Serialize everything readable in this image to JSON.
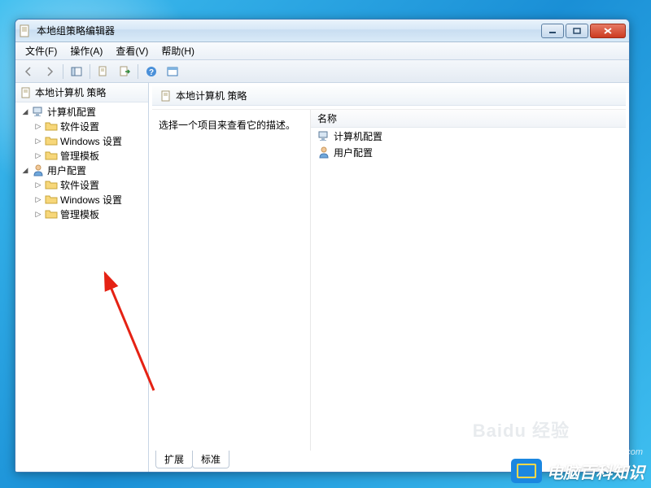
{
  "window": {
    "title": "本地组策略编辑器"
  },
  "menu": {
    "file": "文件(F)",
    "action": "操作(A)",
    "view": "查看(V)",
    "help": "帮助(H)"
  },
  "tree": {
    "root": "本地计算机 策略",
    "computer_config": "计算机配置",
    "software_settings": "软件设置",
    "windows_settings": "Windows 设置",
    "admin_templates": "管理模板",
    "user_config": "用户配置"
  },
  "main": {
    "header": "本地计算机 策略",
    "description": "选择一个项目来查看它的描述。",
    "column_name": "名称",
    "items": {
      "computer": "计算机配置",
      "user": "用户配置"
    }
  },
  "tabs": {
    "extended": "扩展",
    "standard": "标准"
  },
  "watermark": {
    "baidu": "Baidu 经验",
    "url": "www.pc-daily.com",
    "brand": "电脑百科知识"
  }
}
